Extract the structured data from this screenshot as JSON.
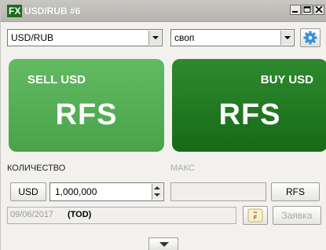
{
  "window": {
    "logo": "FX",
    "title": "USD/RUB #6"
  },
  "selectors": {
    "instrument": "USD/RUB",
    "deal_type": "своп"
  },
  "tiles": {
    "sell": {
      "side_label": "SELL USD",
      "price": "RFS"
    },
    "buy": {
      "side_label": "BUY USD",
      "price": "RFS"
    }
  },
  "amount": {
    "label": "КОЛИЧЕСТВО",
    "currency_button": "USD",
    "value": "1,000,000",
    "max_label": "МАКС",
    "rfs_button": "RFS"
  },
  "settlement": {
    "date": "09/06/2017",
    "tenor": "(TOD)",
    "request_button": "Заявка"
  },
  "colors": {
    "sell_tile": "#5bb55b",
    "buy_tile": "#1f7a1f",
    "accent_blue": "#3a8fd6"
  }
}
